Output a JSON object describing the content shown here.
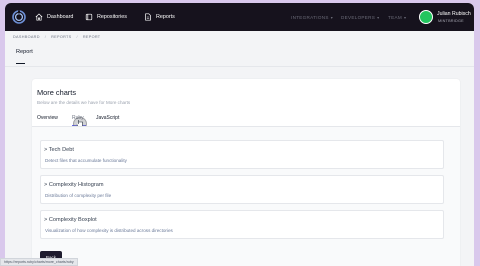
{
  "nav": {
    "items": [
      {
        "label": "Dashboard",
        "icon": "home-icon"
      },
      {
        "label": "Repositories",
        "icon": "repository-icon"
      },
      {
        "label": "Reports",
        "icon": "document-icon"
      }
    ],
    "right": [
      {
        "label": "INTEGRATIONS"
      },
      {
        "label": "DEVELOPERS"
      },
      {
        "label": "TEAM"
      }
    ],
    "user": {
      "name": "Julian Rubisch",
      "org": "MINTBRIDGE"
    }
  },
  "breadcrumb": [
    "DASHBOARD",
    "REPORTS",
    "REPORT"
  ],
  "page": {
    "title": "Report"
  },
  "card": {
    "title": "More charts",
    "subtitle": "Below are the details we have for More charts",
    "tabs": [
      {
        "label": "Overview"
      },
      {
        "label": "Ruby"
      },
      {
        "label": "JavaScript"
      }
    ],
    "sections": [
      {
        "title": "> Tech Debt",
        "description": "Detect files that accumulate functionality"
      },
      {
        "title": "> Complexity Histogram",
        "description": "Distribution of complexity per file"
      },
      {
        "title": "> Complexity Boxplot",
        "description": "Visualization of how complexity is distributed across directories"
      }
    ],
    "back_label": "Back"
  },
  "status_url": "https://reports.ruby/charts/more_charts/ruby"
}
